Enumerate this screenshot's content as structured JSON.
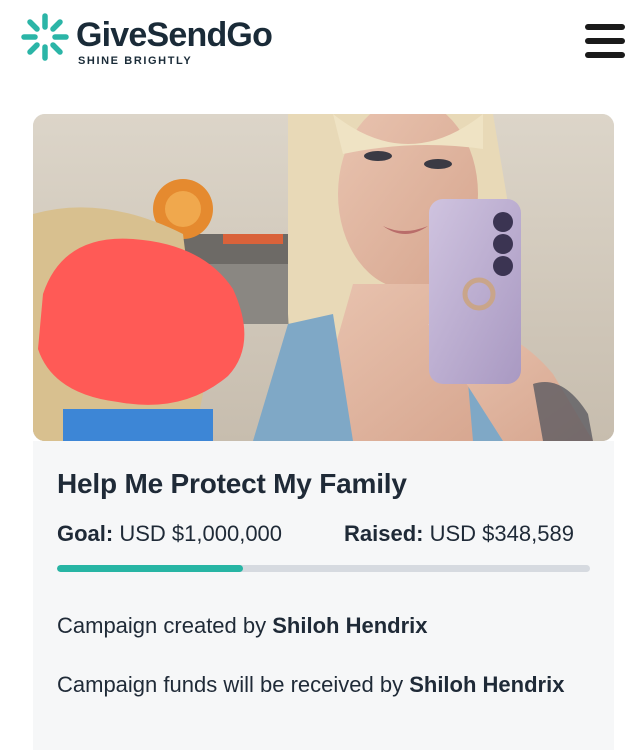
{
  "brand": {
    "name": "GiveSendGo",
    "tagline": "SHINE BRIGHTLY",
    "accent_color": "#27b5a4",
    "mark_color": "#2bb5a7"
  },
  "header": {
    "menu_icon": "hamburger-menu-icon"
  },
  "campaign": {
    "title": "Help Me Protect My Family",
    "goal_label": "Goal:",
    "goal_value": "USD $1,000,000",
    "raised_label": "Raised:",
    "raised_value": "USD $348,589",
    "progress_fraction": 0.348589,
    "created_by_prefix": "Campaign created by",
    "creator_name": "Shiloh Hendrix",
    "funds_prefix": "Campaign funds will be received by",
    "recipient_name": "Shiloh Hendrix"
  }
}
